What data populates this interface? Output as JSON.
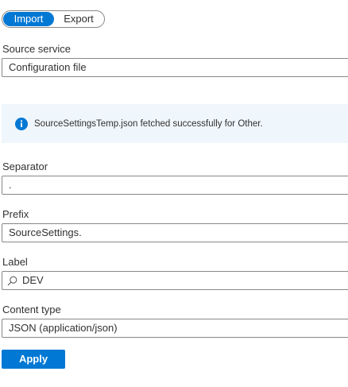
{
  "mode_toggle": {
    "import_label": "Import",
    "export_label": "Export",
    "selected": "Import"
  },
  "source_service": {
    "label": "Source service",
    "value": "Configuration file"
  },
  "info_message": {
    "icon": "info-icon",
    "text": "SourceSettingsTemp.json fetched successfully for Other."
  },
  "separator": {
    "label": "Separator",
    "value": "."
  },
  "prefix": {
    "label": "Prefix",
    "value": "SourceSettings."
  },
  "label_field": {
    "label": "Label",
    "value": "DEV",
    "icon": "search-icon"
  },
  "content_type": {
    "label": "Content type",
    "value": "JSON (application/json)"
  },
  "apply_button": {
    "label": "Apply"
  },
  "colors": {
    "accent": "#0078d4",
    "info_background": "#eff6fc",
    "border": "#8a8886"
  }
}
